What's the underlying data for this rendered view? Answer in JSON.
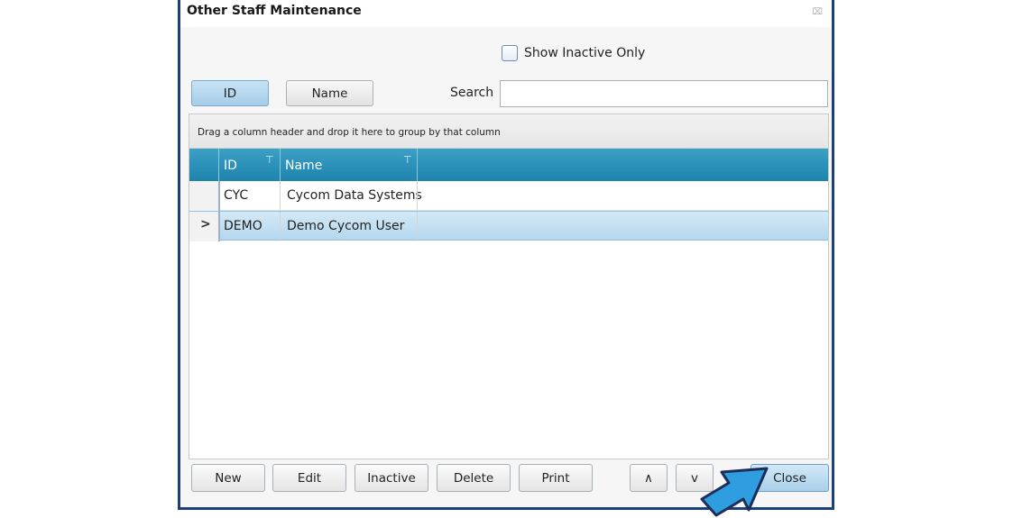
{
  "window": {
    "title": "Other Staff Maintenance",
    "close_glyph": "⌧"
  },
  "filters": {
    "show_inactive_label": "Show Inactive Only",
    "show_inactive_checked": false
  },
  "sort_toggle": {
    "id_label": "ID",
    "name_label": "Name",
    "active": "ID"
  },
  "search": {
    "label": "Search",
    "value": ""
  },
  "grid": {
    "group_hint": "Drag a column header and drop it here to group by that column",
    "columns": [
      "ID",
      "Name"
    ],
    "rows": [
      {
        "id": "CYC",
        "name": "Cycom Data Systems",
        "selected": false
      },
      {
        "id": "DEMO",
        "name": "Demo Cycom User",
        "selected": true
      }
    ],
    "current_row_marker": ">",
    "header_color": "#2a92bb",
    "selected_color": "#c3e0f2"
  },
  "buttons": {
    "new": "New",
    "edit": "Edit",
    "inactive": "Inactive",
    "delete": "Delete",
    "print": "Print",
    "up": "∧",
    "down": "v",
    "close": "Close"
  },
  "annotation": {
    "pointer_icon": "blue-arrow-pointer-icon",
    "pointer_color": "#2e9ee0"
  }
}
